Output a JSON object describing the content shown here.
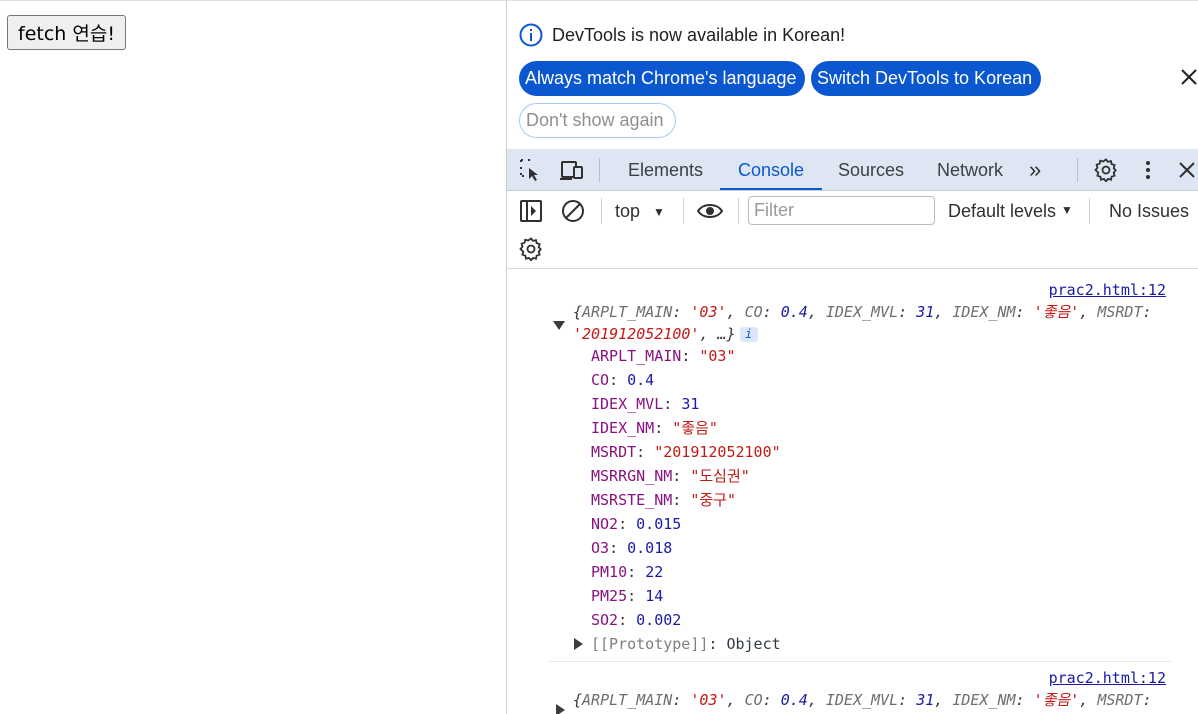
{
  "page": {
    "fetch_button_label": "fetch 연습!"
  },
  "infobar": {
    "message": "DevTools is now available in Korean!",
    "always_match_label": "Always match Chrome's language",
    "switch_label": "Switch DevTools to Korean",
    "dont_show_label": "Don't show again"
  },
  "tabs": {
    "elements": "Elements",
    "console": "Console",
    "sources": "Sources",
    "network": "Network",
    "more": "»"
  },
  "toolbar": {
    "context": "top",
    "filter_placeholder": "Filter",
    "levels": "Default levels",
    "issues": "No Issues"
  },
  "console": {
    "messages": [
      {
        "source": "prac2.html:12",
        "summary": {
          "open": "{",
          "k1": "ARPLT_MAIN",
          "v1": "'03'",
          "k2": "CO",
          "v2": "0.4",
          "k3": "IDEX_MVL",
          "v3": "31",
          "k4": "IDEX_NM",
          "v4": "'좋음'",
          "k5": "MSRDT",
          "v5": "'201912052100'",
          "tail": ", …}"
        },
        "badge": "i",
        "properties": [
          {
            "key": "ARPLT_MAIN",
            "value": "\"03\"",
            "type": "string"
          },
          {
            "key": "CO",
            "value": "0.4",
            "type": "number"
          },
          {
            "key": "IDEX_MVL",
            "value": "31",
            "type": "number"
          },
          {
            "key": "IDEX_NM",
            "value": "\"좋음\"",
            "type": "string"
          },
          {
            "key": "MSRDT",
            "value": "\"201912052100\"",
            "type": "string"
          },
          {
            "key": "MSRRGN_NM",
            "value": "\"도심권\"",
            "type": "string"
          },
          {
            "key": "MSRSTE_NM",
            "value": "\"중구\"",
            "type": "string"
          },
          {
            "key": "NO2",
            "value": "0.015",
            "type": "number"
          },
          {
            "key": "O3",
            "value": "0.018",
            "type": "number"
          },
          {
            "key": "PM10",
            "value": "22",
            "type": "number"
          },
          {
            "key": "PM25",
            "value": "14",
            "type": "number"
          },
          {
            "key": "SO2",
            "value": "0.002",
            "type": "number"
          }
        ],
        "prototype_key": "[[Prototype]]",
        "prototype_value": "Object"
      },
      {
        "source": "prac2.html:12",
        "summary": {
          "open": "{",
          "k1": "ARPLT_MAIN",
          "v1": "'03'",
          "k2": "CO",
          "v2": "0.4",
          "k3": "IDEX_MVL",
          "v3": "31",
          "k4": "IDEX_NM",
          "v4": "'좋음'",
          "k5": "MSRDT"
        }
      }
    ]
  },
  "colors": {
    "accent": "#0b57d0",
    "tabbar_bg": "#dfe6f3",
    "string": "#c41a16",
    "number": "#1a1aa6",
    "prop_key": "#881280"
  }
}
